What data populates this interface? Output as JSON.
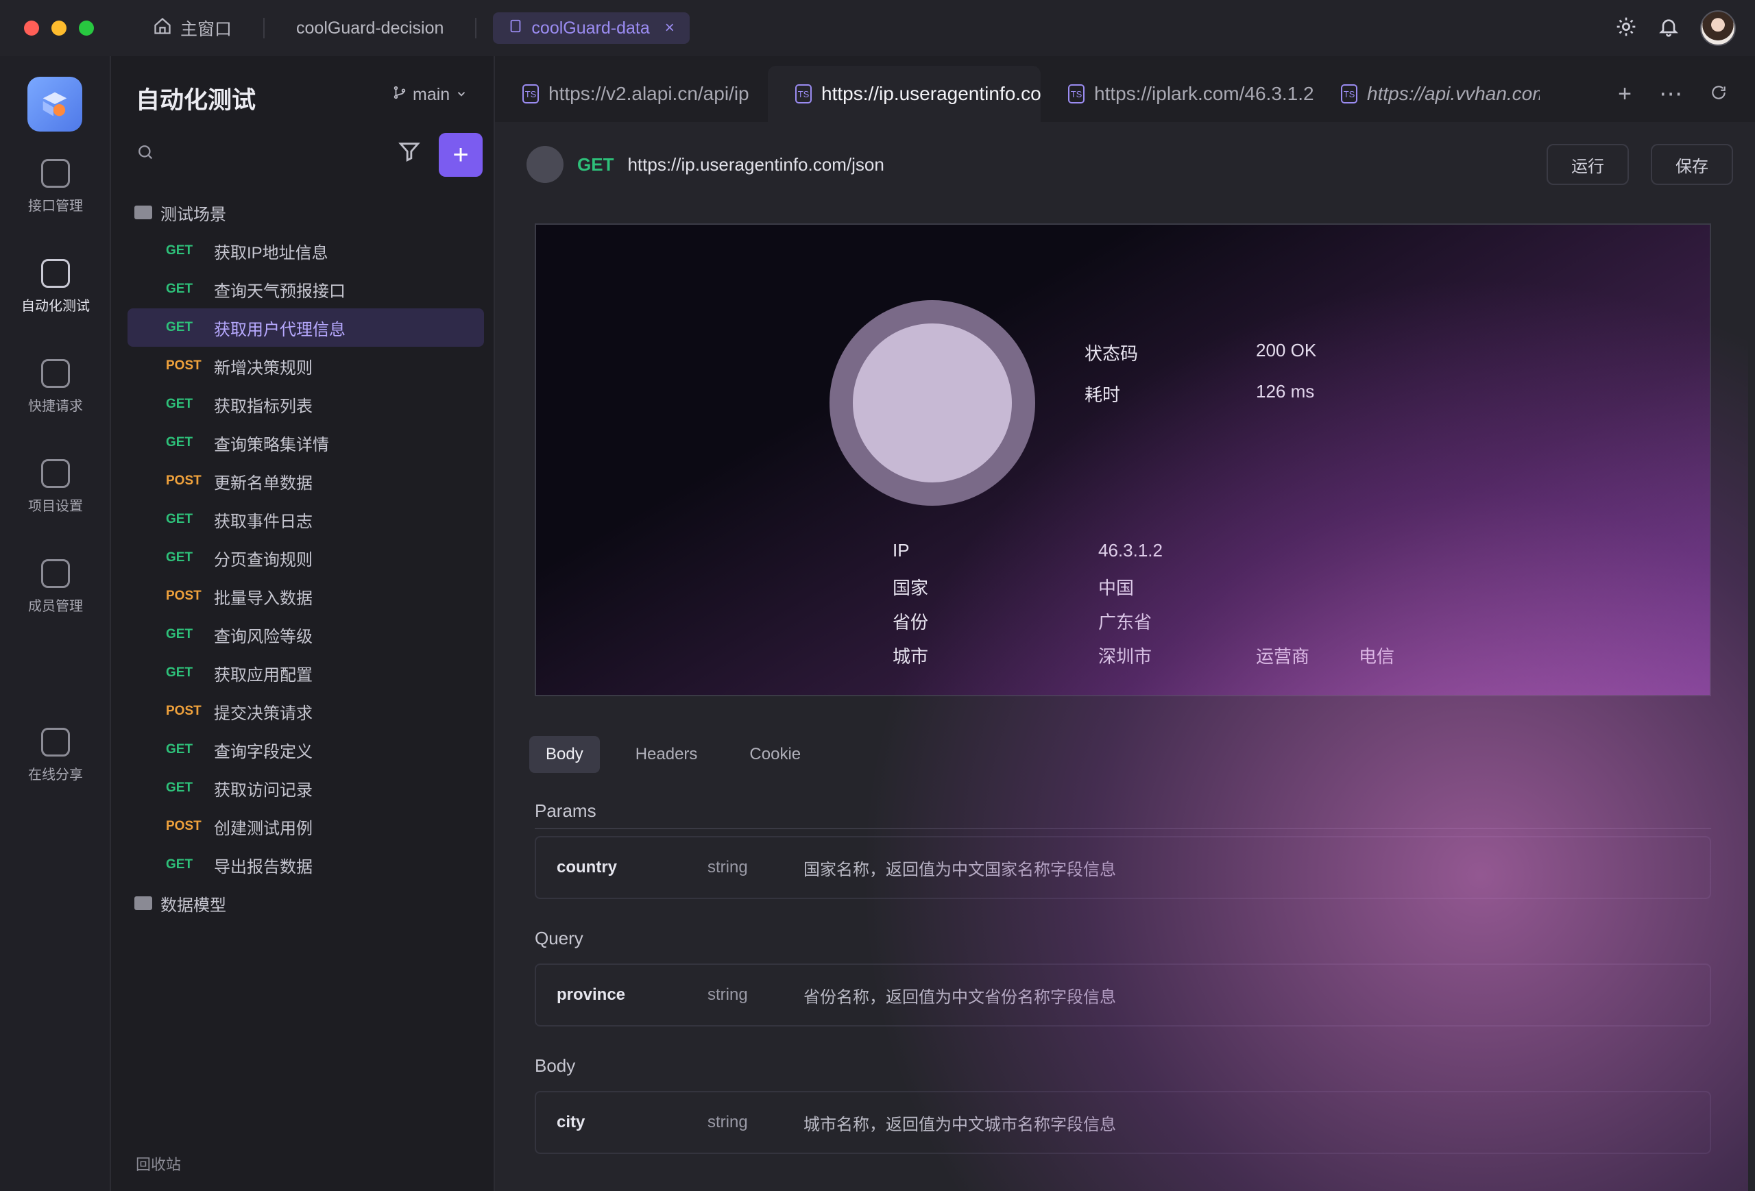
{
  "window": {
    "tabs": [
      {
        "label": "主窗口",
        "icon": "home-icon"
      },
      {
        "label": "coolGuard-decision"
      },
      {
        "label": "coolGuard-data",
        "active": true,
        "icon": "document-icon",
        "closable": true
      }
    ],
    "right_icons": [
      "gear-icon",
      "bell-icon",
      "avatar"
    ]
  },
  "rail": {
    "logo": "app-logo",
    "items": [
      {
        "label": "接口管理",
        "icon": "api-icon"
      },
      {
        "label": "自动化测试",
        "icon": "automation-icon"
      },
      {
        "label": "快捷请求",
        "icon": "request-icon"
      },
      {
        "label": "项目设置",
        "icon": "settings-icon"
      },
      {
        "label": "成员管理",
        "icon": "members-icon"
      },
      {
        "label": "在线分享",
        "icon": "share-icon"
      }
    ]
  },
  "panel": {
    "title": "自动化测试",
    "branch": "main",
    "search_placeholder": "",
    "tree": [
      {
        "type": "folder",
        "label": "测试场景"
      },
      {
        "type": "api",
        "method": "GET",
        "label": "获取IP地址信息"
      },
      {
        "type": "api",
        "method": "GET",
        "label": "查询天气预报接口"
      },
      {
        "type": "api",
        "method": "GET",
        "label": "获取用户代理信息",
        "selected": true
      },
      {
        "type": "api",
        "method": "POST",
        "label": "新增决策规则"
      },
      {
        "type": "api",
        "method": "GET",
        "label": "获取指标列表"
      },
      {
        "type": "api",
        "method": "GET",
        "label": "查询策略集详情"
      },
      {
        "type": "api",
        "method": "POST",
        "label": "更新名单数据"
      },
      {
        "type": "api",
        "method": "GET",
        "label": "获取事件日志"
      },
      {
        "type": "api",
        "method": "GET",
        "label": "分页查询规则"
      },
      {
        "type": "api",
        "method": "POST",
        "label": "批量导入数据"
      },
      {
        "type": "api",
        "method": "GET",
        "label": "查询风险等级"
      },
      {
        "type": "api",
        "method": "GET",
        "label": "获取应用配置"
      },
      {
        "type": "api",
        "method": "POST",
        "label": "提交决策请求"
      },
      {
        "type": "api",
        "method": "GET",
        "label": "查询字段定义"
      },
      {
        "type": "api",
        "method": "GET",
        "label": "获取访问记录"
      },
      {
        "type": "api",
        "method": "POST",
        "label": "创建测试用例"
      },
      {
        "type": "api",
        "method": "GET",
        "label": "导出报告数据"
      },
      {
        "type": "folder",
        "label": "数据模型"
      }
    ],
    "footer": "回收站"
  },
  "doc_tabs": [
    {
      "label": "https://v2.alapi.cn/api/ip",
      "active": false
    },
    {
      "label": "https://ip.useragentinfo.com/json",
      "active": true
    },
    {
      "label": "https://iplark.com/46.3.1.2",
      "active": false
    },
    {
      "label": "https://api.vvhan.com/api/ipInfo",
      "active": false,
      "italic": true
    }
  ],
  "request": {
    "method": "GET",
    "url": "https://ip.useragentinfo.com/json",
    "buttons": [
      "运行",
      "保存"
    ]
  },
  "result_card": {
    "pairs": [
      {
        "k": "状态码",
        "v": "200 OK"
      },
      {
        "k": "耗时",
        "v": "126 ms"
      },
      {
        "k": "IP",
        "v": "46.3.1.2"
      },
      {
        "k": "国家",
        "v": "中国"
      },
      {
        "k": "省份",
        "v": "广东省"
      },
      {
        "k": "城市",
        "v": "深圳市"
      },
      {
        "k": "运营商",
        "v": "电信"
      }
    ]
  },
  "response": {
    "tabs": [
      "Body",
      "Headers",
      "Cookie"
    ],
    "section1": "Params",
    "rows1": [
      {
        "key": "country",
        "type": "string",
        "desc": "国家名称，返回值为中文国家名称字段信息"
      }
    ],
    "section2": "Query",
    "rows2": [
      {
        "key": "province",
        "type": "string",
        "desc": "省份名称，返回值为中文省份名称字段信息"
      }
    ],
    "section3": "Body",
    "rows3": [
      {
        "key": "city",
        "type": "string",
        "desc": "城市名称，返回值为中文城市名称字段信息"
      }
    ]
  },
  "colors": {
    "accent": "#7b5cf0",
    "get": "#2ec17a",
    "post": "#f0a23c"
  }
}
